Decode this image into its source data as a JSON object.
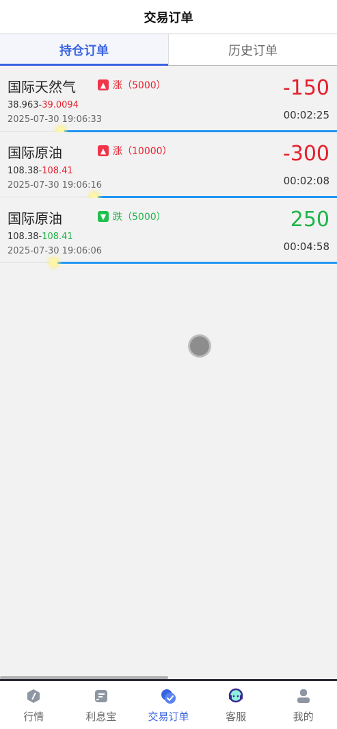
{
  "header": {
    "title": "交易订单"
  },
  "tabs": [
    {
      "label": "持仓订单",
      "active": true
    },
    {
      "label": "历史订单",
      "active": false
    }
  ],
  "orders": [
    {
      "name": "国际天然气",
      "direction_label": "涨（5000）",
      "direction": "up",
      "open_price": "38.963",
      "separator": "-",
      "current_price": "39.0094",
      "time": "2025-07-30 19:06:33",
      "pnl": "-150",
      "duration": "00:02:25",
      "progress_fraction": 0.82
    },
    {
      "name": "国际原油",
      "direction_label": "涨（10000）",
      "direction": "up",
      "open_price": "108.38",
      "separator": "-",
      "current_price": "108.41",
      "time": "2025-07-30 19:06:16",
      "pnl": "-300",
      "duration": "00:02:08",
      "progress_fraction": 0.72
    },
    {
      "name": "国际原油",
      "direction_label": "跌（5000）",
      "direction": "down",
      "open_price": "108.38",
      "separator": "-",
      "current_price": "108.41",
      "time": "2025-07-30 19:06:06",
      "pnl": "250",
      "duration": "00:04:58",
      "progress_fraction": 0.84
    }
  ],
  "tabbar": [
    {
      "label": "行情",
      "icon": "compass-icon",
      "active": false
    },
    {
      "label": "利息宝",
      "icon": "wallet-icon",
      "active": false
    },
    {
      "label": "交易订单",
      "icon": "orders-icon",
      "active": true
    },
    {
      "label": "客服",
      "icon": "headset-icon",
      "active": false
    },
    {
      "label": "我的",
      "icon": "user-icon",
      "active": false
    }
  ],
  "colors": {
    "accent": "#3a63e0",
    "up": "#e5202e",
    "down": "#1fb34a",
    "progress": "#2196f3"
  }
}
